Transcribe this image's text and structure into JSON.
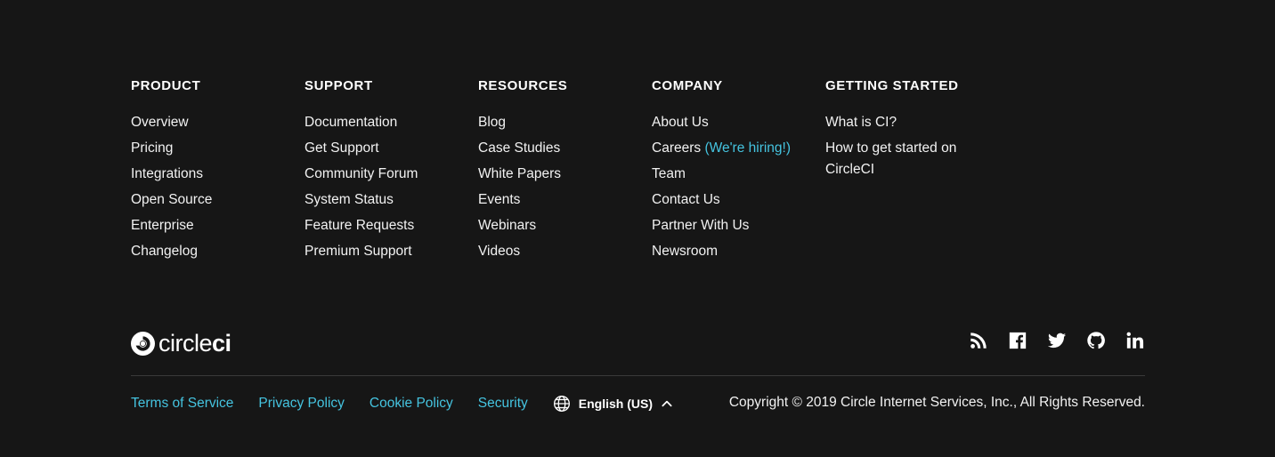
{
  "columns": [
    {
      "heading": "PRODUCT",
      "links": [
        "Overview",
        "Pricing",
        "Integrations",
        "Open Source",
        "Enterprise",
        "Changelog"
      ]
    },
    {
      "heading": "SUPPORT",
      "links": [
        "Documentation",
        "Get Support",
        "Community Forum",
        "System Status",
        "Feature Requests",
        "Premium Support"
      ]
    },
    {
      "heading": "RESOURCES",
      "links": [
        "Blog",
        "Case Studies",
        "White Papers",
        "Events",
        "Webinars",
        "Videos"
      ]
    },
    {
      "heading": "COMPANY",
      "links": [
        "About Us",
        "Careers",
        "Team",
        "Contact Us",
        "Partner With Us",
        "Newsroom"
      ],
      "careers_badge": "(We're hiring!)"
    },
    {
      "heading": "GETTING STARTED",
      "links": [
        "What is CI?",
        "How to get started on CircleCI"
      ]
    }
  ],
  "logo": {
    "text_regular": "circle",
    "text_bold": "ci"
  },
  "social": [
    {
      "name": "rss-icon"
    },
    {
      "name": "facebook-icon"
    },
    {
      "name": "twitter-icon"
    },
    {
      "name": "github-icon"
    },
    {
      "name": "linkedin-icon"
    }
  ],
  "legal": {
    "links": [
      "Terms of Service",
      "Privacy Policy",
      "Cookie Policy",
      "Security"
    ]
  },
  "language": {
    "label": "English (US)",
    "icon": "globe-icon",
    "caret_icon": "chevron-up-icon"
  },
  "copyright": "Copyright © 2019 Circle Internet Services, Inc., All Rights Reserved.",
  "colors": {
    "background": "#161616",
    "accent": "#45c4e0",
    "text": "#ffffff"
  }
}
